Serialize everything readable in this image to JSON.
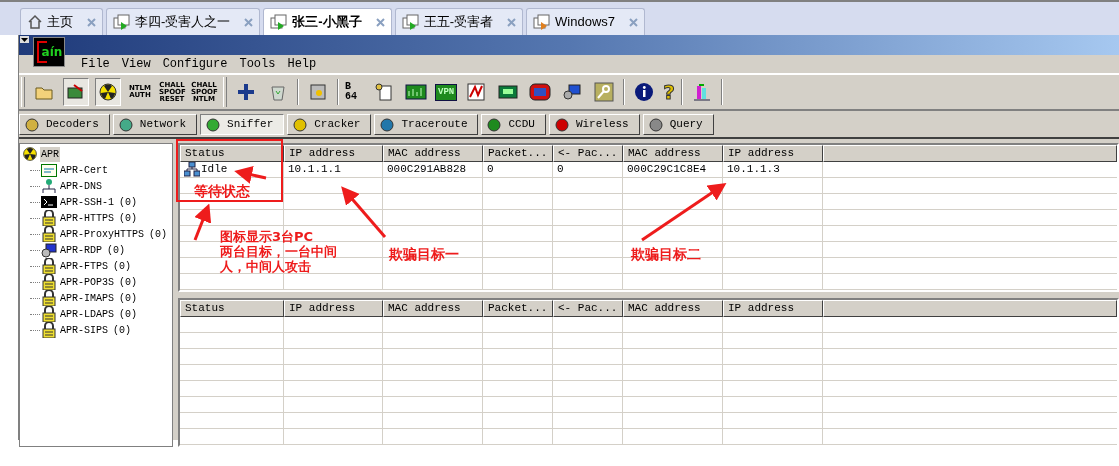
{
  "vm_tabs": [
    {
      "label": "主页",
      "kind": "home",
      "selected": false
    },
    {
      "label": "李四-受害人之一",
      "kind": "vm",
      "selected": false
    },
    {
      "label": "张三-小黑子",
      "kind": "vm",
      "selected": true
    },
    {
      "label": "王五-受害者",
      "kind": "vm",
      "selected": false
    },
    {
      "label": "Windows7",
      "kind": "vm",
      "selected": false
    }
  ],
  "logo": {
    "text": "aín"
  },
  "menu": [
    {
      "label": "File"
    },
    {
      "label": "View"
    },
    {
      "label": "Configure"
    },
    {
      "label": "Tools"
    },
    {
      "label": "Help"
    }
  ],
  "toolbar": [
    {
      "kind": "grip"
    },
    {
      "kind": "icon"
    },
    {
      "kind": "icon",
      "pressed": true
    },
    {
      "kind": "icon",
      "pressed": true
    },
    {
      "kind": "text",
      "label": "NTLM AUTH"
    },
    {
      "kind": "text",
      "label": "CHALL SPOOF RESET"
    },
    {
      "kind": "text",
      "label": "CHALL SPOOF NTLM"
    },
    {
      "kind": "grip"
    },
    {
      "kind": "icon"
    },
    {
      "kind": "icon"
    },
    {
      "kind": "sep"
    },
    {
      "kind": "icon"
    },
    {
      "kind": "sep"
    },
    {
      "kind": "text",
      "label": "B 64"
    },
    {
      "kind": "icon"
    },
    {
      "kind": "icon"
    },
    {
      "kind": "text",
      "label": "VPN"
    },
    {
      "kind": "icon"
    },
    {
      "kind": "icon"
    },
    {
      "kind": "icon"
    },
    {
      "kind": "icon"
    },
    {
      "kind": "icon"
    },
    {
      "kind": "sep"
    },
    {
      "kind": "icon"
    },
    {
      "kind": "text",
      "label": "?"
    },
    {
      "kind": "sep"
    },
    {
      "kind": "icon"
    },
    {
      "kind": "sep"
    }
  ],
  "tabs": [
    {
      "label": "Decoders",
      "selected": false
    },
    {
      "label": "Network",
      "selected": false
    },
    {
      "label": "Sniffer",
      "selected": true
    },
    {
      "label": "Cracker",
      "selected": false
    },
    {
      "label": "Traceroute",
      "selected": false
    },
    {
      "label": "CCDU",
      "selected": false
    },
    {
      "label": "Wireless",
      "selected": false
    },
    {
      "label": "Query",
      "selected": false
    }
  ],
  "tree": {
    "label": "APR",
    "expanded": true,
    "children": [
      {
        "label": "APR-Cert"
      },
      {
        "label": "APR-DNS"
      },
      {
        "label": "APR-SSH-1",
        "count": "(0)"
      },
      {
        "label": "APR-HTTPS",
        "count": "(0)"
      },
      {
        "label": "APR-ProxyHTTPS",
        "count": "(0)"
      },
      {
        "label": "APR-RDP",
        "count": "(0)"
      },
      {
        "label": "APR-FTPS",
        "count": "(0)"
      },
      {
        "label": "APR-POP3S",
        "count": "(0)"
      },
      {
        "label": "APR-IMAPS",
        "count": "(0)"
      },
      {
        "label": "APR-LDAPS",
        "count": "(0)"
      },
      {
        "label": "APR-SIPS",
        "count": "(0)"
      }
    ]
  },
  "upper_table": {
    "columns": [
      "Status",
      "IP address",
      "MAC address",
      "Packet...",
      "<- Pac...",
      "MAC address",
      "IP address"
    ],
    "rows": [
      [
        "Idle",
        "10.1.1.1",
        "000C291AB828",
        "0",
        "0",
        "000C29C1C8E4",
        "10.1.1.3"
      ]
    ]
  },
  "lower_table": {
    "columns": [
      "Status",
      "IP address",
      "MAC address",
      "Packet...",
      "<- Pac...",
      "MAC address",
      "IP address"
    ]
  },
  "annotations": {
    "status_note": "等待状态",
    "icon_note": [
      "图标显示3台PC",
      "两台目标，一台中间",
      "人，中间人攻击"
    ],
    "target_one": "欺骗目标一",
    "target_two": "欺骗目标二"
  }
}
